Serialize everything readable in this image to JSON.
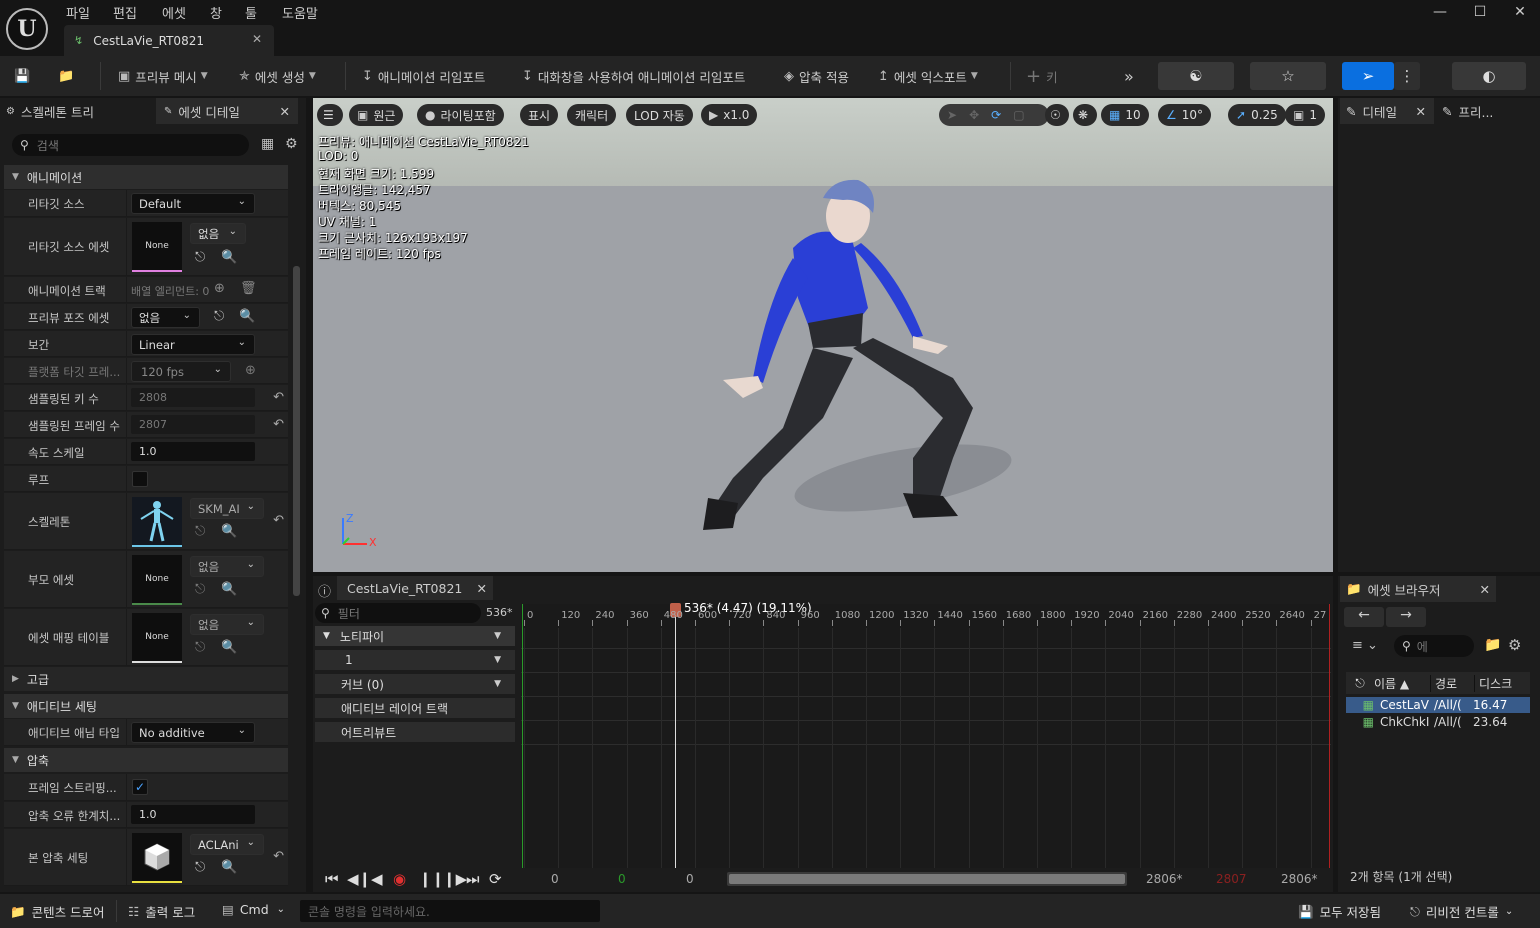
{
  "menu": [
    "파일",
    "편집",
    "에셋",
    "창",
    "툴",
    "도움말"
  ],
  "document_tab": {
    "title": "CestLaVie_RT0821"
  },
  "toolbar": {
    "preview_mesh": "프리뷰 메시",
    "create_asset": "에셋 생성",
    "reimport": "애니메이션 리임포트",
    "reimport_dialog": "대화창을 사용하여 애니메이션 리임포트",
    "apply_compression": "압축 적용",
    "export_asset": "에셋 익스포트",
    "key": "키"
  },
  "left_panel": {
    "tabs": [
      "스켈레톤 트리",
      "에셋 디테일"
    ],
    "search_placeholder": "검색",
    "sections": {
      "animation": "애니메이션",
      "advanced": "고급",
      "additive": "애디티브 세팅",
      "compression": "압축"
    },
    "props": {
      "retarget_source": {
        "label": "리타깃 소스",
        "value": "Default"
      },
      "retarget_source_asset": {
        "label": "리타깃 소스 에셋",
        "thumb": "None",
        "combo": "없음"
      },
      "anim_track": {
        "label": "애니메이션 트랙",
        "value": "배열 엘리먼트: 0"
      },
      "preview_pose": {
        "label": "프리뷰 포즈 에셋",
        "value": "없음"
      },
      "interpolation": {
        "label": "보간",
        "value": "Linear"
      },
      "platform_target": {
        "label": "플랫폼 타깃 프레...",
        "value": "120 fps"
      },
      "sampled_keys": {
        "label": "샘플링된 키 수",
        "value": "2808"
      },
      "sampled_frames": {
        "label": "샘플링된 프레임 수",
        "value": "2807"
      },
      "rate_scale": {
        "label": "속도 스케일",
        "value": "1.0"
      },
      "loop": {
        "label": "루프"
      },
      "skeleton": {
        "label": "스켈레톤",
        "combo": "SKM_AI"
      },
      "parent_asset": {
        "label": "부모 에셋",
        "thumb": "None",
        "combo": "없음"
      },
      "asset_mapping": {
        "label": "에셋 매핑 테이블",
        "thumb": "None",
        "combo": "없음"
      },
      "additive_type": {
        "label": "애디티브 애님 타입",
        "value": "No additive"
      },
      "frame_strip": {
        "label": "프레임 스트리핑..."
      },
      "error_threshold": {
        "label": "압축 오류 한계치...",
        "value": "1.0"
      },
      "bone_compression": {
        "label": "본 압축 세팅",
        "combo": "ACLAni"
      }
    }
  },
  "viewport": {
    "buttons": {
      "perspective": "원근",
      "lighting": "라이팅포함",
      "show": "표시",
      "character": "캐릭터",
      "lod": "LOD 자동",
      "speed": "x1.0",
      "grid": "10",
      "angle": "10°",
      "scale": "0.25",
      "camera": "1"
    },
    "overlay": [
      "프리뷰: 애니메이션 CestLaVie_RT0821",
      "LOD: 0",
      "현재 화면 크기: 1.599",
      "트라이앵글: 142,457",
      "버텍스: 80,545",
      "UV 채널: 1",
      "크기 근사치: 126x193x197",
      "프레임 레이트: 120 fps"
    ],
    "axis": {
      "z": "Z",
      "x": "X"
    }
  },
  "right_panel": {
    "tabs": [
      "디테일",
      "프리..."
    ]
  },
  "asset_browser": {
    "title": "에셋 브라우저",
    "search_placeholder": "에",
    "columns": [
      "이름",
      "경로",
      "디스크"
    ],
    "rows": [
      {
        "name": "CestLaV",
        "path": "/All/(",
        "size": "16.47"
      },
      {
        "name": "ChkChkI",
        "path": "/All/(",
        "size": "23.64"
      }
    ],
    "footer": "2개 항목 (1개 선택)"
  },
  "sequencer": {
    "tab": "CestLaVie_RT0821",
    "filter_placeholder": "필터",
    "frame_field": "536*",
    "playhead": "536* (4.47) (19.11%)",
    "tracks": [
      {
        "label": "노티파이",
        "dropdown": true
      },
      {
        "label": "1",
        "dropdown": true
      },
      {
        "label": "커브  (0)",
        "dropdown": true
      },
      {
        "label": "애디티브 레이어 트랙",
        "dropdown": false
      },
      {
        "label": "어트리뷰트",
        "dropdown": false
      }
    ],
    "ticks": [
      "0",
      "120",
      "240",
      "360",
      "480",
      "600",
      "720",
      "840",
      "960",
      "1080",
      "1200",
      "1320",
      "1440",
      "1560",
      "1680",
      "1800",
      "1920",
      "2040",
      "2160",
      "2280",
      "2400",
      "2520",
      "2640",
      "27"
    ],
    "bottom": {
      "start": "0",
      "green": "0",
      "view_start": "0",
      "view_end": "2806*",
      "red": "2807",
      "end": "2806*"
    }
  },
  "status_bar": {
    "content_drawer": "콘텐츠 드로어",
    "output_log": "출력 로그",
    "cmd": "Cmd",
    "console_placeholder": "콘솔 명령을 입력하세요.",
    "save_all": "모두 저장됨",
    "revision_control": "리비전 컨트롤"
  }
}
